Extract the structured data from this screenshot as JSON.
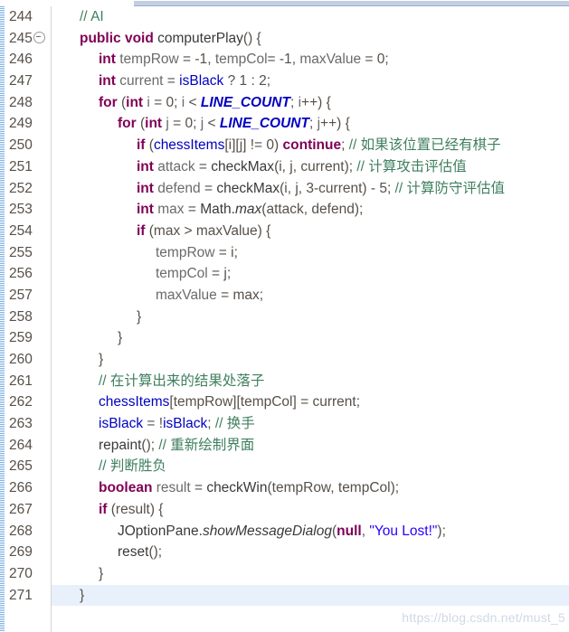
{
  "window": {
    "title": "Java Source Editor",
    "language": "Java",
    "theme": "eclipse-light"
  },
  "watermark": {
    "text": "https://blog.csdn.net/must_5"
  },
  "gutter": {
    "first_line": 244,
    "last_line": 271,
    "fold_marker_line": 245,
    "fold_marker_icon": "collapse-minus-circle-icon"
  },
  "editor": {
    "highlighted_line": 271,
    "colors": {
      "keyword": "#7f0055",
      "field": "#0000c0",
      "static_field": "#0000c0",
      "string": "#2a00ff",
      "comment": "#3f7f5f",
      "plain": "#575049",
      "line_number": "#787878",
      "current_line_background": "#e8f0fb",
      "change_marker": "#7fb2e5",
      "tab_underline": "#c3d0e3"
    },
    "lines": [
      {
        "number": 244,
        "indent": 1,
        "tokens": [
          {
            "t": "cmt",
            "s": "// AI"
          }
        ]
      },
      {
        "number": 245,
        "indent": 1,
        "fold": true,
        "tokens": [
          {
            "t": "kw",
            "s": "public"
          },
          {
            "t": "plain",
            "s": " "
          },
          {
            "t": "kw",
            "s": "void"
          },
          {
            "t": "plain",
            "s": " "
          },
          {
            "t": "method",
            "s": "computerPlay"
          },
          {
            "t": "plain",
            "s": "() {"
          }
        ]
      },
      {
        "number": 246,
        "indent": 2,
        "tokens": [
          {
            "t": "kw",
            "s": "int"
          },
          {
            "t": "plain",
            "s": " "
          },
          {
            "t": "ident",
            "s": "tempRow"
          },
          {
            "t": "plain",
            "s": " = "
          },
          {
            "t": "num",
            "s": "-1"
          },
          {
            "t": "plain",
            "s": ", "
          },
          {
            "t": "ident",
            "s": "tempCol"
          },
          {
            "t": "plain",
            "s": "= "
          },
          {
            "t": "num",
            "s": "-1"
          },
          {
            "t": "plain",
            "s": ", "
          },
          {
            "t": "ident",
            "s": "maxValue"
          },
          {
            "t": "plain",
            "s": " = "
          },
          {
            "t": "num",
            "s": "0"
          },
          {
            "t": "plain",
            "s": ";"
          }
        ]
      },
      {
        "number": 247,
        "indent": 2,
        "tokens": [
          {
            "t": "kw",
            "s": "int"
          },
          {
            "t": "plain",
            "s": " "
          },
          {
            "t": "ident",
            "s": "current"
          },
          {
            "t": "plain",
            "s": " = "
          },
          {
            "t": "field",
            "s": "isBlack"
          },
          {
            "t": "plain",
            "s": " ? "
          },
          {
            "t": "num",
            "s": "1"
          },
          {
            "t": "plain",
            "s": " : "
          },
          {
            "t": "num",
            "s": "2"
          },
          {
            "t": "plain",
            "s": ";"
          }
        ]
      },
      {
        "number": 248,
        "indent": 2,
        "tokens": [
          {
            "t": "kw",
            "s": "for"
          },
          {
            "t": "plain",
            "s": " ("
          },
          {
            "t": "kw",
            "s": "int"
          },
          {
            "t": "plain",
            "s": " "
          },
          {
            "t": "ident",
            "s": "i"
          },
          {
            "t": "plain",
            "s": " = "
          },
          {
            "t": "num",
            "s": "0"
          },
          {
            "t": "plain",
            "s": "; "
          },
          {
            "t": "ident",
            "s": "i"
          },
          {
            "t": "plain",
            "s": " < "
          },
          {
            "t": "sfield",
            "s": "LINE_COUNT"
          },
          {
            "t": "plain",
            "s": "; "
          },
          {
            "t": "ident",
            "s": "i"
          },
          {
            "t": "plain",
            "s": "++) {"
          }
        ]
      },
      {
        "number": 249,
        "indent": 3,
        "tokens": [
          {
            "t": "kw",
            "s": "for"
          },
          {
            "t": "plain",
            "s": " ("
          },
          {
            "t": "kw",
            "s": "int"
          },
          {
            "t": "plain",
            "s": " "
          },
          {
            "t": "ident",
            "s": "j"
          },
          {
            "t": "plain",
            "s": " = "
          },
          {
            "t": "num",
            "s": "0"
          },
          {
            "t": "plain",
            "s": "; "
          },
          {
            "t": "ident",
            "s": "j"
          },
          {
            "t": "plain",
            "s": " < "
          },
          {
            "t": "sfield",
            "s": "LINE_COUNT"
          },
          {
            "t": "plain",
            "s": "; "
          },
          {
            "t": "ident",
            "s": "j"
          },
          {
            "t": "plain",
            "s": "++) {"
          }
        ]
      },
      {
        "number": 250,
        "indent": 4,
        "tokens": [
          {
            "t": "kw",
            "s": "if"
          },
          {
            "t": "plain",
            "s": " ("
          },
          {
            "t": "field",
            "s": "chessItems"
          },
          {
            "t": "plain",
            "s": "[i][j] != "
          },
          {
            "t": "num",
            "s": "0"
          },
          {
            "t": "plain",
            "s": ") "
          },
          {
            "t": "kw",
            "s": "continue"
          },
          {
            "t": "plain",
            "s": ";  "
          },
          {
            "t": "cmt",
            "s": "// 如果该位置已经有棋子"
          }
        ]
      },
      {
        "number": 251,
        "indent": 4,
        "tokens": [
          {
            "t": "kw",
            "s": "int"
          },
          {
            "t": "plain",
            "s": " "
          },
          {
            "t": "ident",
            "s": "attack"
          },
          {
            "t": "plain",
            "s": " = "
          },
          {
            "t": "method",
            "s": "checkMax"
          },
          {
            "t": "plain",
            "s": "(i, j, current);  "
          },
          {
            "t": "cmt",
            "s": "// 计算攻击评估值"
          }
        ]
      },
      {
        "number": 252,
        "indent": 4,
        "tokens": [
          {
            "t": "kw",
            "s": "int"
          },
          {
            "t": "plain",
            "s": " "
          },
          {
            "t": "ident",
            "s": "defend"
          },
          {
            "t": "plain",
            "s": " = "
          },
          {
            "t": "method",
            "s": "checkMax"
          },
          {
            "t": "plain",
            "s": "(i, j, 3-current) - "
          },
          {
            "t": "num",
            "s": "5"
          },
          {
            "t": "plain",
            "s": ";  "
          },
          {
            "t": "cmt",
            "s": "// 计算防守评估值"
          }
        ]
      },
      {
        "number": 253,
        "indent": 4,
        "tokens": [
          {
            "t": "kw",
            "s": "int"
          },
          {
            "t": "plain",
            "s": " "
          },
          {
            "t": "ident",
            "s": "max"
          },
          {
            "t": "plain",
            "s": " = "
          },
          {
            "t": "method",
            "s": "Math."
          },
          {
            "t": "smethod",
            "s": "max"
          },
          {
            "t": "plain",
            "s": "(attack, defend);"
          }
        ]
      },
      {
        "number": 254,
        "indent": 4,
        "tokens": [
          {
            "t": "kw",
            "s": "if"
          },
          {
            "t": "plain",
            "s": " (max > maxValue) {"
          }
        ]
      },
      {
        "number": 255,
        "indent": 5,
        "tokens": [
          {
            "t": "ident",
            "s": "tempRow"
          },
          {
            "t": "plain",
            "s": " = i;"
          }
        ]
      },
      {
        "number": 256,
        "indent": 5,
        "tokens": [
          {
            "t": "ident",
            "s": "tempCol"
          },
          {
            "t": "plain",
            "s": " = j;"
          }
        ]
      },
      {
        "number": 257,
        "indent": 5,
        "tokens": [
          {
            "t": "ident",
            "s": "maxValue"
          },
          {
            "t": "plain",
            "s": " = max;"
          }
        ]
      },
      {
        "number": 258,
        "indent": 4,
        "tokens": [
          {
            "t": "plain",
            "s": "}"
          }
        ]
      },
      {
        "number": 259,
        "indent": 3,
        "tokens": [
          {
            "t": "plain",
            "s": "}"
          }
        ]
      },
      {
        "number": 260,
        "indent": 2,
        "tokens": [
          {
            "t": "plain",
            "s": "}"
          }
        ]
      },
      {
        "number": 261,
        "indent": 2,
        "tokens": [
          {
            "t": "cmt",
            "s": "// 在计算出来的结果处落子"
          }
        ]
      },
      {
        "number": 262,
        "indent": 2,
        "tokens": [
          {
            "t": "field",
            "s": "chessItems"
          },
          {
            "t": "plain",
            "s": "[tempRow][tempCol] = current;"
          }
        ]
      },
      {
        "number": 263,
        "indent": 2,
        "tokens": [
          {
            "t": "field",
            "s": "isBlack"
          },
          {
            "t": "plain",
            "s": " = !"
          },
          {
            "t": "field",
            "s": "isBlack"
          },
          {
            "t": "plain",
            "s": ";  "
          },
          {
            "t": "cmt",
            "s": "// 换手"
          }
        ]
      },
      {
        "number": 264,
        "indent": 2,
        "tokens": [
          {
            "t": "method",
            "s": "repaint"
          },
          {
            "t": "plain",
            "s": "(); "
          },
          {
            "t": "cmt",
            "s": "// 重新绘制界面"
          }
        ]
      },
      {
        "number": 265,
        "indent": 2,
        "tokens": [
          {
            "t": "cmt",
            "s": "// 判断胜负"
          }
        ]
      },
      {
        "number": 266,
        "indent": 2,
        "tokens": [
          {
            "t": "kw",
            "s": "boolean"
          },
          {
            "t": "plain",
            "s": " "
          },
          {
            "t": "ident",
            "s": "result"
          },
          {
            "t": "plain",
            "s": " = "
          },
          {
            "t": "method",
            "s": "checkWin"
          },
          {
            "t": "plain",
            "s": "(tempRow, tempCol);"
          }
        ]
      },
      {
        "number": 267,
        "indent": 2,
        "tokens": [
          {
            "t": "kw",
            "s": "if"
          },
          {
            "t": "plain",
            "s": " (result) {"
          }
        ]
      },
      {
        "number": 268,
        "indent": 3,
        "tokens": [
          {
            "t": "method",
            "s": "JOptionPane."
          },
          {
            "t": "smethod",
            "s": "showMessageDialog"
          },
          {
            "t": "plain",
            "s": "("
          },
          {
            "t": "kw",
            "s": "null"
          },
          {
            "t": "plain",
            "s": ", "
          },
          {
            "t": "str",
            "s": "\"You Lost!\""
          },
          {
            "t": "plain",
            "s": ");"
          }
        ]
      },
      {
        "number": 269,
        "indent": 3,
        "tokens": [
          {
            "t": "method",
            "s": "reset"
          },
          {
            "t": "plain",
            "s": "();"
          }
        ]
      },
      {
        "number": 270,
        "indent": 2,
        "tokens": [
          {
            "t": "plain",
            "s": "}"
          }
        ]
      },
      {
        "number": 271,
        "indent": 1,
        "tokens": [
          {
            "t": "plain",
            "s": "}"
          }
        ]
      }
    ]
  }
}
